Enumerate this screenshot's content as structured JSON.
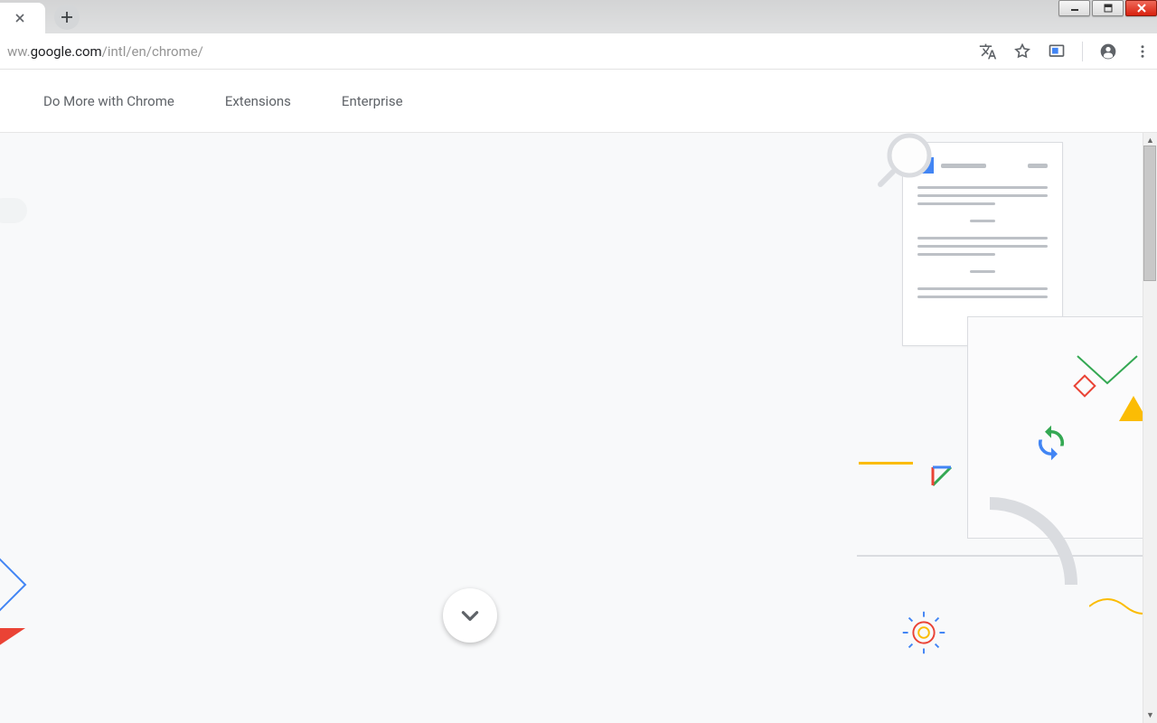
{
  "addressbar": {
    "url_prefix": "ww.",
    "url_host": "google.com",
    "url_path": "/intl/en/chrome/"
  },
  "nav": {
    "items": [
      "Do More with Chrome",
      "Extensions",
      "Enterprise"
    ]
  }
}
